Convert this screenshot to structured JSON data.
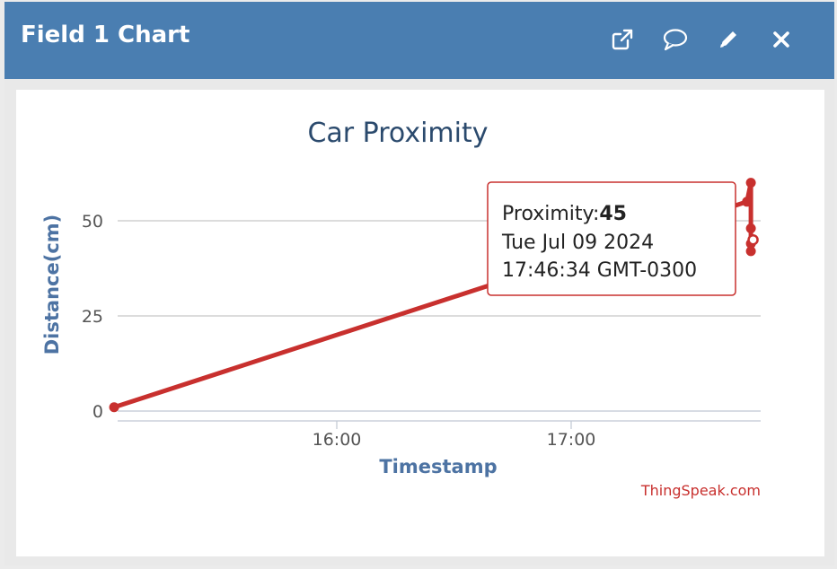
{
  "widget": {
    "title": "Field 1 Chart",
    "icons": [
      "external-link-icon",
      "comment-icon",
      "pencil-icon",
      "close-icon"
    ]
  },
  "chart_data": {
    "type": "line",
    "title": "Car Proximity",
    "xlabel": "Timestamp",
    "ylabel": "Distance(cm)",
    "x_ticks": [
      "16:00",
      "17:00"
    ],
    "y_ticks": [
      0,
      25,
      50
    ],
    "ylim": [
      0,
      60
    ],
    "series": [
      {
        "color": "#c8302e",
        "points": [
          {
            "x": "15:03",
            "y": 1
          },
          {
            "x": "17:45",
            "y": 55
          },
          {
            "x": "17:46",
            "y": 60
          },
          {
            "x": "17:46",
            "y": 44
          },
          {
            "x": "17:46",
            "y": 48
          },
          {
            "x": "17:46",
            "y": 42
          },
          {
            "x": "17:46:34",
            "y": 45
          }
        ]
      }
    ],
    "tooltip": {
      "label": "Proximity:",
      "value": "45",
      "date": "Tue Jul 09 2024",
      "time": "17:46:34 GMT-0300"
    },
    "credit": "ThingSpeak.com",
    "grid": true
  }
}
